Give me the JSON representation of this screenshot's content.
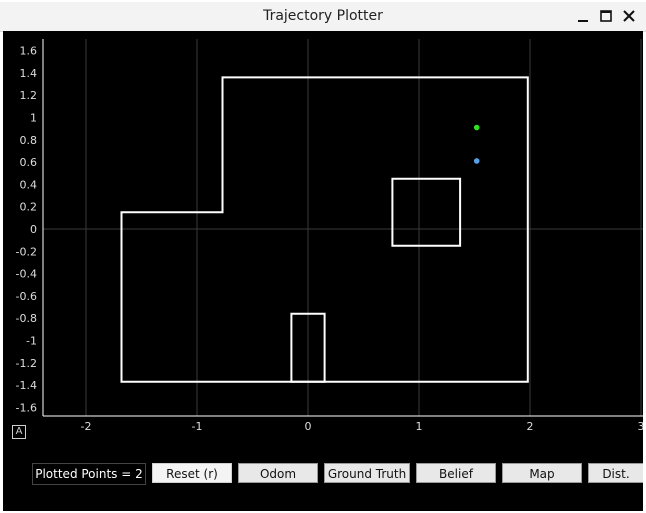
{
  "window": {
    "title": "Trajectory Plotter",
    "controls": [
      "minimize-icon",
      "maximize-icon",
      "close-icon"
    ]
  },
  "plot": {
    "background": "#000000",
    "grid_color": "#3a3a3a",
    "axis_color": "#ffffff",
    "map_color": "#ffffff",
    "autoscale_label": "A",
    "x_ticks": [
      "-2",
      "-1",
      "0",
      "1",
      "2",
      "3"
    ],
    "y_ticks": [
      "1.6",
      "1.4",
      "1.2",
      "1",
      "0.8",
      "0.6",
      "0.4",
      "0.2",
      "0",
      "-0.2",
      "-0.4",
      "-0.6",
      "-0.8",
      "-1",
      "-1.2",
      "-1.4",
      "-1.6"
    ]
  },
  "map": {
    "outer_boundary": [
      [
        -1.68,
        0.15
      ],
      [
        -0.77,
        0.15
      ],
      [
        -0.77,
        1.36
      ],
      [
        1.98,
        1.36
      ],
      [
        1.98,
        -1.37
      ],
      [
        -1.68,
        -1.37
      ]
    ],
    "obstacle_box": [
      [
        0.76,
        0.45
      ],
      [
        1.37,
        0.45
      ],
      [
        1.37,
        -0.15
      ],
      [
        0.76,
        -0.15
      ]
    ],
    "slot": [
      [
        -0.15,
        -1.37
      ],
      [
        -0.15,
        -0.76
      ],
      [
        0.15,
        -0.76
      ],
      [
        0.15,
        -1.37
      ]
    ]
  },
  "points": [
    {
      "name": "green-point",
      "x": 1.52,
      "y": 0.91,
      "color": "#33dd22"
    },
    {
      "name": "blue-point",
      "x": 1.52,
      "y": 0.61,
      "color": "#5aa0e6"
    }
  ],
  "controls": {
    "counter_text": "Plotted Points = 2",
    "buttons": [
      "Reset (r)",
      "Odom",
      "Ground Truth",
      "Belief",
      "Map",
      "Dist."
    ]
  }
}
